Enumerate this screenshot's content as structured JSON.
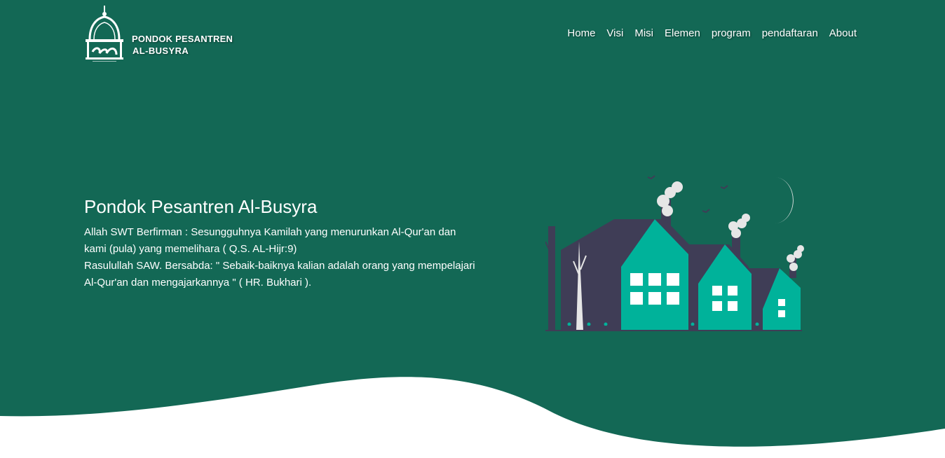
{
  "header": {
    "logo_line1": "PONDOK PESANTREN",
    "logo_line2": "AL-BUSYRA",
    "nav": [
      {
        "label": "Home"
      },
      {
        "label": "Visi"
      },
      {
        "label": "Misi"
      },
      {
        "label": "Elemen"
      },
      {
        "label": "program"
      },
      {
        "label": "pendaftaran"
      },
      {
        "label": "About"
      }
    ]
  },
  "hero": {
    "title": "Pondok Pesantren Al-Busyra",
    "quran_quote": "Allah SWT Berfirman : Sesungguhnya Kamilah yang menurunkan Al-Qur'an dan kami (pula) yang memelihara ( Q.S. AL-Hijr:9)",
    "hadith_quote": "Rasulullah SAW. Bersabda: \" Sebaik-baiknya kalian adalah orang yang mempelajari Al-Qur'an dan mengajarkannya \" ( HR. Bukhari )."
  },
  "colors": {
    "background": "#136855",
    "house": "#00b29a",
    "building_dark": "#3f3d56",
    "smoke": "#e6e6e6",
    "text": "#ffffff"
  },
  "icons": {
    "logo": "mosque-dome-emblem",
    "illustration": "houses-night-illustration"
  }
}
